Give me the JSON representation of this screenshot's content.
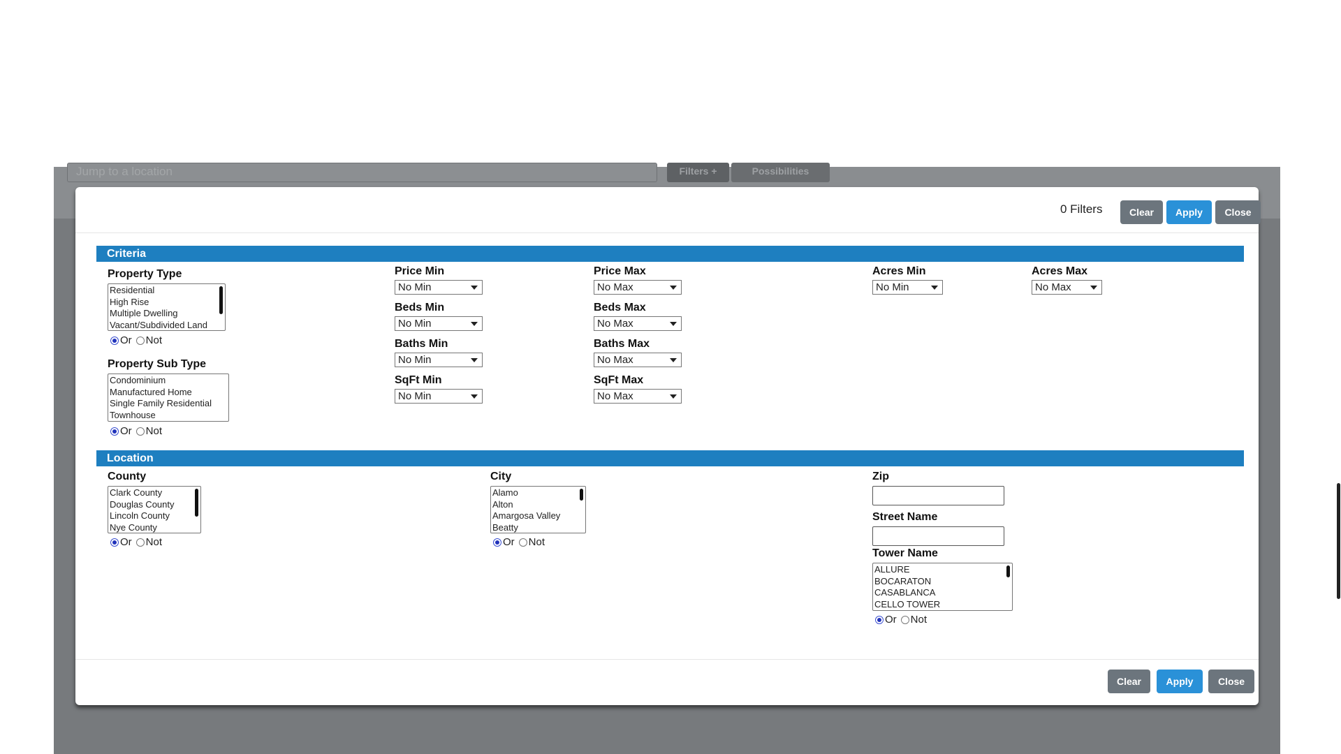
{
  "background": {
    "jump_placeholder": "Jump to a location",
    "filters_tab": "Filters +",
    "possibilities_tab": "Possibilities"
  },
  "modal": {
    "filter_count": "0 Filters",
    "clear": "Clear",
    "apply": "Apply",
    "close": "Close"
  },
  "criteria": {
    "title": "Criteria",
    "property_type": {
      "label": "Property Type",
      "options": [
        "Residential",
        "High Rise",
        "Multiple Dwelling",
        "Vacant/Subdivided Land"
      ]
    },
    "property_sub_type": {
      "label": "Property Sub Type",
      "options": [
        "Condominium",
        "Manufactured Home",
        "Single Family Residential",
        "Townhouse"
      ]
    },
    "or_label": "Or",
    "not_label": "Not",
    "price_min": {
      "label": "Price Min",
      "value": "No Min"
    },
    "price_max": {
      "label": "Price Max",
      "value": "No Max"
    },
    "beds_min": {
      "label": "Beds Min",
      "value": "No Min"
    },
    "beds_max": {
      "label": "Beds Max",
      "value": "No Max"
    },
    "baths_min": {
      "label": "Baths Min",
      "value": "No Min"
    },
    "baths_max": {
      "label": "Baths Max",
      "value": "No Max"
    },
    "sqft_min": {
      "label": "SqFt Min",
      "value": "No Min"
    },
    "sqft_max": {
      "label": "SqFt Max",
      "value": "No Max"
    },
    "acres_min": {
      "label": "Acres Min",
      "value": "No Min"
    },
    "acres_max": {
      "label": "Acres Max",
      "value": "No Max"
    }
  },
  "location": {
    "title": "Location",
    "county": {
      "label": "County",
      "options": [
        "Clark County",
        "Douglas County",
        "Lincoln County",
        "Nye County"
      ]
    },
    "city": {
      "label": "City",
      "options": [
        "Alamo",
        "Alton",
        "Amargosa Valley",
        "Beatty"
      ]
    },
    "zip": {
      "label": "Zip",
      "value": ""
    },
    "street_name": {
      "label": "Street Name",
      "value": ""
    },
    "tower_name": {
      "label": "Tower Name",
      "options": [
        "ALLURE",
        "BOCARATON",
        "CASABLANCA",
        "CELLO TOWER"
      ]
    }
  }
}
